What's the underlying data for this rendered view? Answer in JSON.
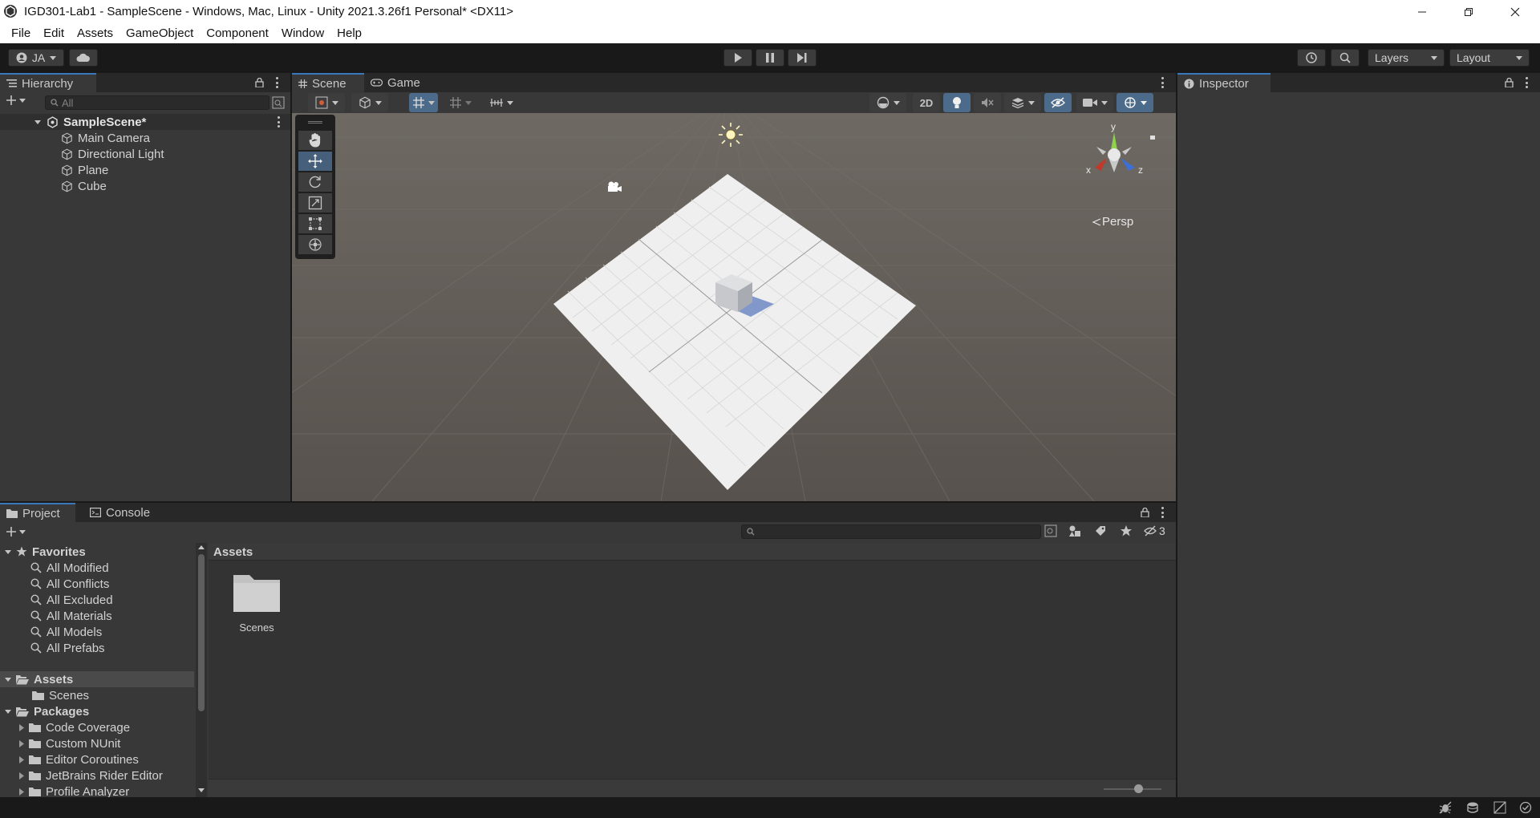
{
  "window": {
    "title": "IGD301-Lab1 - SampleScene - Windows, Mac, Linux - Unity 2021.3.26f1 Personal* <DX11>",
    "controls": [
      "minimize",
      "restore",
      "close"
    ]
  },
  "menu": [
    "File",
    "Edit",
    "Assets",
    "GameObject",
    "Component",
    "Window",
    "Help"
  ],
  "toolbar": {
    "account_label": "JA",
    "layers_label": "Layers",
    "layout_label": "Layout"
  },
  "hierarchy": {
    "tab_label": "Hierarchy",
    "search_placeholder": "All",
    "scene_name": "SampleScene*",
    "objects": [
      "Main Camera",
      "Directional Light",
      "Plane",
      "Cube"
    ]
  },
  "scene_view": {
    "tabs": [
      "Scene",
      "Game"
    ],
    "mode_2d_label": "2D",
    "projection_label": "Persp",
    "axis_labels": {
      "x": "x",
      "y": "y",
      "z": "z"
    },
    "tools": [
      "hand-tool",
      "move-tool",
      "rotate-tool",
      "scale-tool",
      "rect-tool",
      "transform-tool"
    ],
    "active_tool": "move-tool"
  },
  "inspector": {
    "tab_label": "Inspector"
  },
  "project": {
    "tabs": [
      "Project",
      "Console"
    ],
    "favorites_label": "Favorites",
    "favorites": [
      "All Modified",
      "All Conflicts",
      "All Excluded",
      "All Materials",
      "All Models",
      "All Prefabs"
    ],
    "assets_label": "Assets",
    "assets_children": [
      "Scenes"
    ],
    "packages_label": "Packages",
    "packages": [
      "Code Coverage",
      "Custom NUnit",
      "Editor Coroutines",
      "JetBrains Rider Editor",
      "Profile Analyzer"
    ],
    "breadcrumb": "Assets",
    "hidden_count": "3",
    "grid_items": [
      {
        "name": "Scenes",
        "icon": "folder-icon"
      }
    ]
  },
  "colors": {
    "accent": "#3a79bb",
    "panel": "#383838",
    "background": "#191919",
    "scene_bg": "#5f5a55"
  }
}
